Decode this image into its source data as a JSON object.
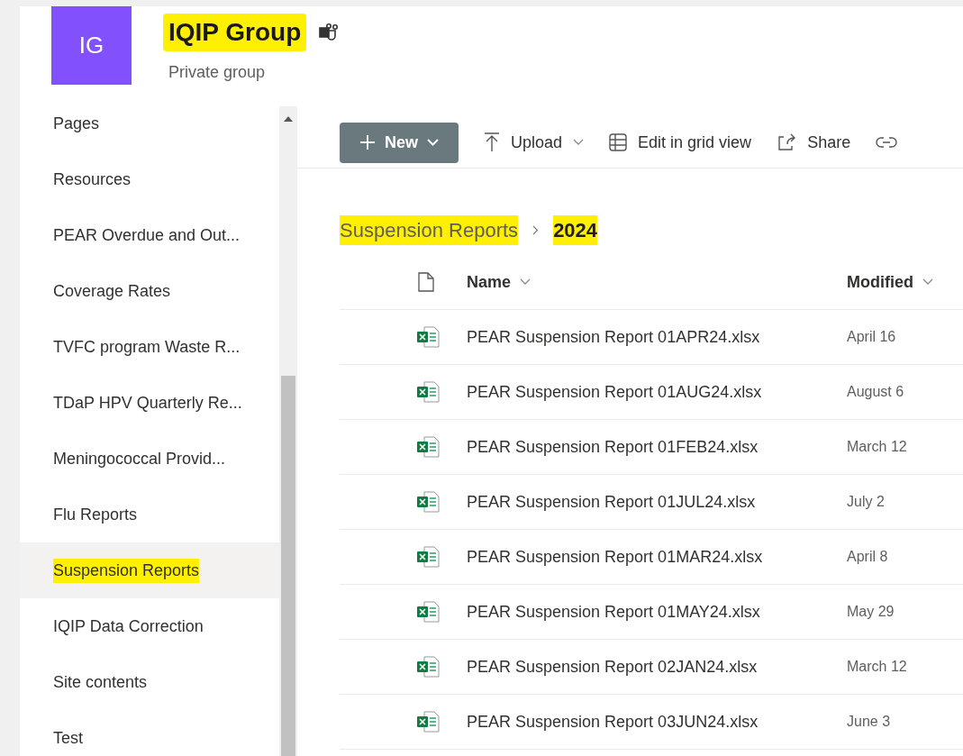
{
  "site": {
    "initials": "IG",
    "title": "IQIP Group",
    "title_highlighted": true,
    "subtitle": "Private group"
  },
  "sidebar": {
    "items": [
      {
        "label": "Pages",
        "selected": false,
        "highlighted": false
      },
      {
        "label": "Resources",
        "selected": false,
        "highlighted": false
      },
      {
        "label": "PEAR Overdue and Out...",
        "selected": false,
        "highlighted": false
      },
      {
        "label": "Coverage Rates",
        "selected": false,
        "highlighted": false
      },
      {
        "label": "TVFC program Waste R...",
        "selected": false,
        "highlighted": false
      },
      {
        "label": "TDaP HPV Quarterly Re...",
        "selected": false,
        "highlighted": false
      },
      {
        "label": "Meningococcal Provid...",
        "selected": false,
        "highlighted": false
      },
      {
        "label": "Flu Reports",
        "selected": false,
        "highlighted": false
      },
      {
        "label": "Suspension Reports",
        "selected": true,
        "highlighted": true
      },
      {
        "label": "IQIP Data Correction",
        "selected": false,
        "highlighted": false
      },
      {
        "label": "Site contents",
        "selected": false,
        "highlighted": false
      },
      {
        "label": "Test",
        "selected": false,
        "highlighted": false
      }
    ]
  },
  "command_bar": [
    {
      "kind": "new",
      "label": "New"
    },
    {
      "kind": "upload",
      "label": "Upload"
    },
    {
      "kind": "grid",
      "label": "Edit in grid view"
    },
    {
      "kind": "share",
      "label": "Share"
    },
    {
      "kind": "link"
    }
  ],
  "breadcrumb": [
    {
      "label": "Suspension Reports",
      "current": false,
      "highlighted": true
    },
    {
      "label": "2024",
      "current": true,
      "highlighted": true
    }
  ],
  "table": {
    "columns": [
      "Name",
      "Modified"
    ],
    "rows": [
      {
        "name": "PEAR Suspension Report 01APR24.xlsx",
        "modified": "April 16"
      },
      {
        "name": "PEAR Suspension Report 01AUG24.xlsx",
        "modified": "August 6"
      },
      {
        "name": "PEAR Suspension Report 01FEB24.xlsx",
        "modified": "March 12"
      },
      {
        "name": "PEAR Suspension Report 01JUL24.xlsx",
        "modified": "July 2"
      },
      {
        "name": "PEAR Suspension Report 01MAR24.xlsx",
        "modified": "April 8"
      },
      {
        "name": "PEAR Suspension Report 01MAY24.xlsx",
        "modified": "May 29"
      },
      {
        "name": "PEAR Suspension Report 02JAN24.xlsx",
        "modified": "March 12"
      },
      {
        "name": "PEAR Suspension Report 03JUN24.xlsx",
        "modified": "June 3"
      }
    ]
  }
}
